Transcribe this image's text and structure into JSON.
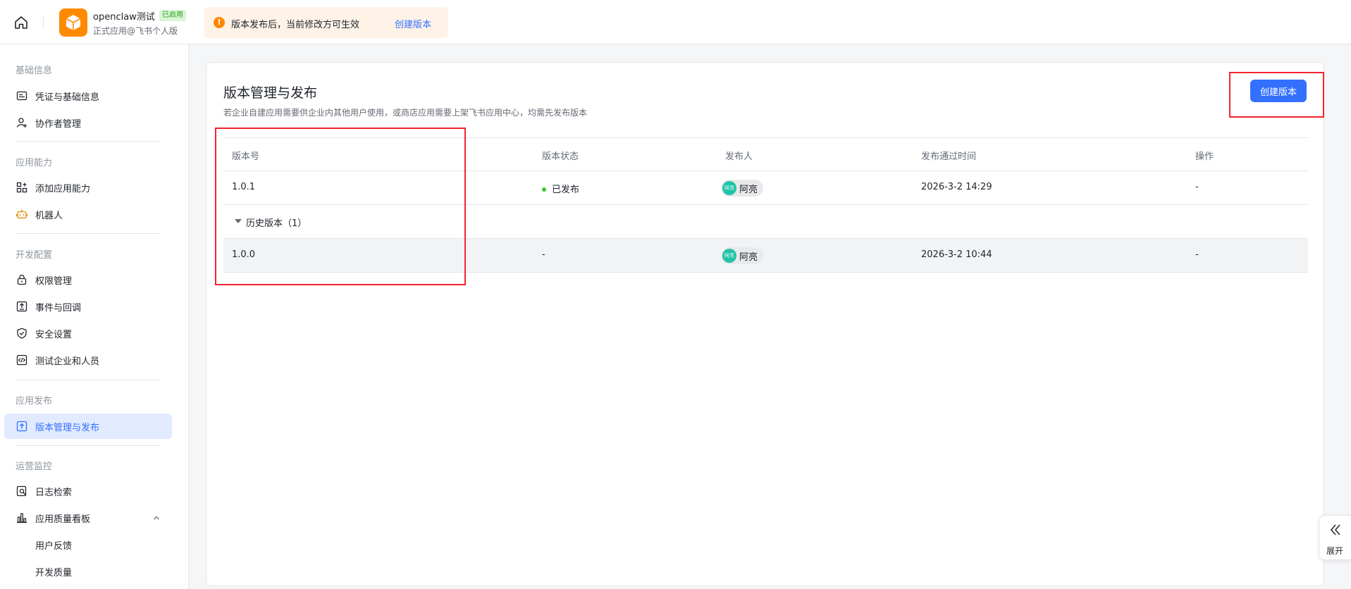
{
  "topbar": {
    "app_name": "openclaw测试",
    "app_badge": "已启用",
    "app_subtitle": "正式应用@飞书个人版",
    "notice_text": "版本发布后，当前修改方可生效",
    "notice_link": "创建版本",
    "notice_icon": "!"
  },
  "sidebar": {
    "groups": [
      "基础信息",
      "应用能力",
      "开发配置",
      "应用发布",
      "运营监控"
    ],
    "items": [
      {
        "label": "凭证与基础信息",
        "icon": "credential-icon"
      },
      {
        "label": "协作者管理",
        "icon": "user-add-icon"
      },
      {
        "label": "添加应用能力",
        "icon": "apps-add-icon"
      },
      {
        "label": "机器人",
        "icon": "robot-icon"
      },
      {
        "label": "权限管理",
        "icon": "lock-icon"
      },
      {
        "label": "事件与回调",
        "icon": "event-icon"
      },
      {
        "label": "安全设置",
        "icon": "shield-icon"
      },
      {
        "label": "测试企业和人员",
        "icon": "code-icon"
      },
      {
        "label": "版本管理与发布",
        "icon": "upload-icon"
      },
      {
        "label": "日志检索",
        "icon": "log-search-icon"
      },
      {
        "label": "应用质量看板",
        "icon": "bar-chart-icon"
      },
      {
        "label": "用户反馈"
      },
      {
        "label": "开发质量"
      }
    ]
  },
  "main": {
    "title": "版本管理与发布",
    "description": "若企业自建应用需要供企业内其他用户使用，或商店应用需要上架飞书应用中心，均需先发布版本",
    "create_button": "创建版本",
    "columns": [
      "版本号",
      "版本状态",
      "发布人",
      "发布通过时间",
      "操作"
    ],
    "current": {
      "version": "1.0.1",
      "status": "已发布",
      "publisher": "阿亮",
      "avatar": "阿亮",
      "time": "2026-3-2 14:29",
      "action": "-"
    },
    "history_label": "历史版本（1）",
    "history": [
      {
        "version": "1.0.0",
        "status": "-",
        "publisher": "阿亮",
        "avatar": "阿亮",
        "time": "2026-3-2 10:44",
        "action": "-"
      }
    ]
  },
  "expand": {
    "label": "展开"
  },
  "colors": {
    "primary": "#3370ff",
    "success": "#34c724",
    "warning": "#ff8800",
    "highlight": "#f5222d"
  }
}
